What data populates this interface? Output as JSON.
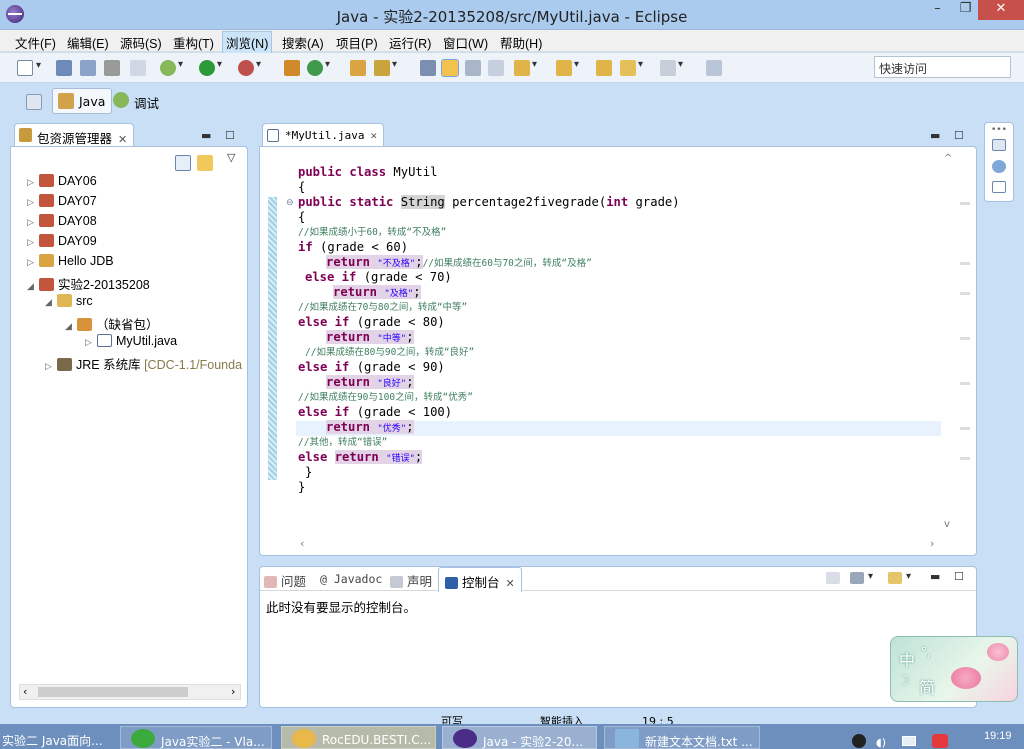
{
  "window": {
    "title": "Java  -  实验2-20135208/src/MyUtil.java  -  Eclipse",
    "minimize": "–",
    "restore": "❐",
    "close": "✕"
  },
  "menu": [
    "文件(F)",
    "编辑(E)",
    "源码(S)",
    "重构(T)",
    "浏览(N)",
    "搜索(A)",
    "项目(P)",
    "运行(R)",
    "窗口(W)",
    "帮助(H)"
  ],
  "menu_active_index": 4,
  "quick_access": {
    "placeholder": "快速访问"
  },
  "perspectives": [
    {
      "label": "Java",
      "active": true
    },
    {
      "label": "调试",
      "active": false
    }
  ],
  "package_explorer": {
    "title": "包资源管理器",
    "tree": [
      {
        "label": "DAY06"
      },
      {
        "label": "DAY07"
      },
      {
        "label": "DAY08"
      },
      {
        "label": "DAY09"
      },
      {
        "label": "Hello JDB"
      },
      {
        "label": "实验2-20135208"
      },
      {
        "label": "src"
      },
      {
        "label": "（缺省包）"
      },
      {
        "label": "MyUtil.java"
      },
      {
        "label": "JRE 系统库",
        "decoration": "[CDC-1.1/Founda"
      }
    ]
  },
  "editor": {
    "tab_label": "*MyUtil.java",
    "code": {
      "l1": {
        "kw": "public class",
        "rest": " MyUtil"
      },
      "l2": "{",
      "l3": {
        "kw1": "public static",
        "type": "String",
        "sig": " percentage2fivegrade(",
        "kw2": "int",
        "end": " grade)"
      },
      "l4": "{",
      "l5": "//如果成绩小于60，转成“不及格”",
      "l6": {
        "kw": "if",
        "rest": " (grade < 60)"
      },
      "l7": {
        "kw": "return",
        "str": "\"不及格\"",
        "end": ";",
        "cmt": "//如果成绩在60与70之间，转成“及格”"
      },
      "l8": {
        "kw": "else if",
        "rest": " (grade < 70)"
      },
      "l9": {
        "kw": "return",
        "str": "\"及格\"",
        "end": ";"
      },
      "l10": "//如果成绩在70与80之间，转成“中等”",
      "l11": {
        "kw": "else if",
        "rest": " (grade < 80)"
      },
      "l12": {
        "kw": "return",
        "str": "\"中等\"",
        "end": ";"
      },
      "l13": "//如果成绩在80与90之间，转成“良好”",
      "l14": {
        "kw": "else if",
        "rest": " (grade < 90)"
      },
      "l15": {
        "kw": "return",
        "str": "\"良好\"",
        "end": ";"
      },
      "l16": "//如果成绩在90与100之间，转成“优秀”",
      "l17": {
        "kw": "else if",
        "rest": " (grade < 100)"
      },
      "l18": {
        "kw": "return",
        "str": "\"优秀\"",
        "end": ";"
      },
      "l19": "//其他，转成“错误”",
      "l20": {
        "kw1": "else",
        "kw2": "return",
        "str": "\"错误\"",
        "end": ";"
      },
      "l21": "}",
      "l22": "}"
    }
  },
  "bottom_panel": {
    "tabs": [
      "问题",
      "Javadoc",
      "声明",
      "控制台"
    ],
    "active_tab": "控制台",
    "console_message": "此时没有要显示的控制台。"
  },
  "ime": {
    "mode1": "中",
    "mode2": "简",
    "punct": "°,"
  },
  "statusbar": {
    "writable": "可写",
    "insert_mode": "智能插入",
    "position": "19 : 5"
  },
  "taskbar": {
    "items": [
      "实验二 Java面向...",
      "Java实验二 - Vla...",
      "RocEDU.BESTI.C...",
      "Java - 实验2-20...",
      "新建文本文档.txt ..."
    ],
    "clock": "19:19"
  }
}
